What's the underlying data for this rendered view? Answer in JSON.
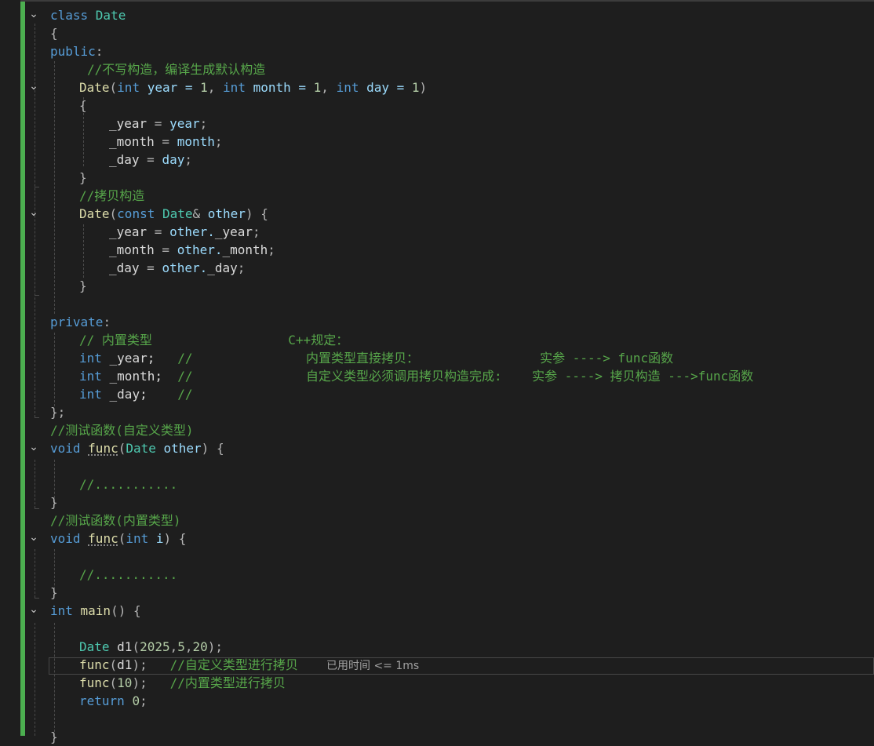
{
  "editor": {
    "lines": [
      {
        "fold": "⌄",
        "tokens": [
          {
            "t": "class ",
            "c": "kw"
          },
          {
            "t": "Date",
            "c": "type"
          }
        ]
      },
      {
        "tokens": [
          {
            "t": "{",
            "c": "punct"
          }
        ]
      },
      {
        "tokens": [
          {
            "t": "public",
            "c": "kw"
          },
          {
            "t": ":",
            "c": "punct"
          }
        ]
      },
      {
        "tokens": [
          {
            "t": "//不写构造，编译生成默认构造",
            "c": "cmt"
          }
        ]
      },
      {
        "fold": "⌄",
        "tokens": [
          {
            "t": "Date",
            "c": "fn"
          },
          {
            "t": "(",
            "c": "punct"
          },
          {
            "t": "int",
            "c": "kw"
          },
          {
            "t": " year = ",
            "c": "param"
          },
          {
            "t": "1",
            "c": "num"
          },
          {
            "t": ", ",
            "c": "punct"
          },
          {
            "t": "int",
            "c": "kw"
          },
          {
            "t": " month = ",
            "c": "param"
          },
          {
            "t": "1",
            "c": "num"
          },
          {
            "t": ", ",
            "c": "punct"
          },
          {
            "t": "int",
            "c": "kw"
          },
          {
            "t": " day = ",
            "c": "param"
          },
          {
            "t": "1",
            "c": "num"
          },
          {
            "t": ")",
            "c": "punct"
          }
        ]
      },
      {
        "tokens": [
          {
            "t": "{",
            "c": "punct"
          }
        ]
      },
      {
        "tokens": [
          {
            "t": "_year",
            "c": "field"
          },
          {
            "t": " = ",
            "c": "punct"
          },
          {
            "t": "year",
            "c": "param"
          },
          {
            "t": ";",
            "c": "punct"
          }
        ]
      },
      {
        "tokens": [
          {
            "t": "_month",
            "c": "field"
          },
          {
            "t": " = ",
            "c": "punct"
          },
          {
            "t": "month",
            "c": "param"
          },
          {
            "t": ";",
            "c": "punct"
          }
        ]
      },
      {
        "tokens": [
          {
            "t": "_day",
            "c": "field"
          },
          {
            "t": " = ",
            "c": "punct"
          },
          {
            "t": "day",
            "c": "param"
          },
          {
            "t": ";",
            "c": "punct"
          }
        ]
      },
      {
        "tokens": [
          {
            "t": "}",
            "c": "punct"
          }
        ]
      },
      {
        "tokens": [
          {
            "t": "//拷贝构造",
            "c": "cmt"
          }
        ]
      },
      {
        "fold": "⌄",
        "tokens": [
          {
            "t": "Date",
            "c": "fn"
          },
          {
            "t": "(",
            "c": "punct"
          },
          {
            "t": "const",
            "c": "kw"
          },
          {
            "t": " ",
            "c": "punct"
          },
          {
            "t": "Date",
            "c": "type"
          },
          {
            "t": "& ",
            "c": "punct"
          },
          {
            "t": "other",
            "c": "param"
          },
          {
            "t": ") {",
            "c": "punct"
          }
        ]
      },
      {
        "tokens": [
          {
            "t": "_year",
            "c": "field"
          },
          {
            "t": " = ",
            "c": "punct"
          },
          {
            "t": "other.",
            "c": "param"
          },
          {
            "t": "_year",
            "c": "field"
          },
          {
            "t": ";",
            "c": "punct"
          }
        ]
      },
      {
        "tokens": [
          {
            "t": "_month",
            "c": "field"
          },
          {
            "t": " = ",
            "c": "punct"
          },
          {
            "t": "other.",
            "c": "param"
          },
          {
            "t": "_month",
            "c": "field"
          },
          {
            "t": ";",
            "c": "punct"
          }
        ]
      },
      {
        "tokens": [
          {
            "t": "_day",
            "c": "field"
          },
          {
            "t": " = ",
            "c": "punct"
          },
          {
            "t": "other.",
            "c": "param"
          },
          {
            "t": "_day",
            "c": "field"
          },
          {
            "t": ";",
            "c": "punct"
          }
        ]
      },
      {
        "tokens": [
          {
            "t": "}",
            "c": "punct"
          }
        ]
      },
      {
        "tokens": []
      },
      {
        "tokens": [
          {
            "t": "private",
            "c": "kw"
          },
          {
            "t": ":",
            "c": "punct"
          }
        ]
      },
      {
        "tokens": [
          {
            "t": "// 内置类型                  C++规定：",
            "c": "cmt"
          }
        ]
      },
      {
        "tokens": [
          {
            "t": "int",
            "c": "kw"
          },
          {
            "t": " _year;   ",
            "c": "field"
          },
          {
            "t": "//               内置类型直接拷贝：                实参 ----> func函数",
            "c": "cmt"
          }
        ]
      },
      {
        "tokens": [
          {
            "t": "int",
            "c": "kw"
          },
          {
            "t": " _month;  ",
            "c": "field"
          },
          {
            "t": "//               自定义类型必须调用拷贝构造完成:    实参 ----> 拷贝构造 --->func函数",
            "c": "cmt"
          }
        ]
      },
      {
        "tokens": [
          {
            "t": "int",
            "c": "kw"
          },
          {
            "t": " _day;    ",
            "c": "field"
          },
          {
            "t": "//",
            "c": "cmt"
          }
        ]
      },
      {
        "tokens": [
          {
            "t": "};",
            "c": "punct"
          }
        ]
      },
      {
        "tokens": [
          {
            "t": "//测试函数(自定义类型)",
            "c": "cmt"
          }
        ]
      },
      {
        "fold": "⌄",
        "tokens": [
          {
            "t": "void ",
            "c": "kw"
          },
          {
            "t": "func",
            "c": "fn",
            "squiggle": true
          },
          {
            "t": "(",
            "c": "punct"
          },
          {
            "t": "Date",
            "c": "type"
          },
          {
            "t": " other",
            "c": "param"
          },
          {
            "t": ") {",
            "c": "punct"
          }
        ]
      },
      {
        "tokens": []
      },
      {
        "tokens": [
          {
            "t": "//...........",
            "c": "cmt"
          }
        ]
      },
      {
        "tokens": [
          {
            "t": "}",
            "c": "punct"
          }
        ]
      },
      {
        "tokens": [
          {
            "t": "//测试函数(内置类型)",
            "c": "cmt"
          }
        ]
      },
      {
        "fold": "⌄",
        "tokens": [
          {
            "t": "void ",
            "c": "kw"
          },
          {
            "t": "func",
            "c": "fn",
            "squiggle": true
          },
          {
            "t": "(",
            "c": "punct"
          },
          {
            "t": "int",
            "c": "kw"
          },
          {
            "t": " i",
            "c": "param"
          },
          {
            "t": ") {",
            "c": "punct"
          }
        ]
      },
      {
        "tokens": []
      },
      {
        "tokens": [
          {
            "t": "//...........",
            "c": "cmt"
          }
        ]
      },
      {
        "tokens": [
          {
            "t": "}",
            "c": "punct"
          }
        ]
      },
      {
        "fold": "⌄",
        "tokens": [
          {
            "t": "int ",
            "c": "kw"
          },
          {
            "t": "main",
            "c": "fn"
          },
          {
            "t": "() {",
            "c": "punct"
          }
        ]
      },
      {
        "tokens": []
      },
      {
        "tokens": [
          {
            "t": "Date",
            "c": "type"
          },
          {
            "t": " d1",
            "c": "field"
          },
          {
            "t": "(",
            "c": "punct"
          },
          {
            "t": "2025",
            "c": "num"
          },
          {
            "t": ",",
            "c": "punct"
          },
          {
            "t": "5",
            "c": "num"
          },
          {
            "t": ",",
            "c": "punct"
          },
          {
            "t": "20",
            "c": "num"
          },
          {
            "t": ");",
            "c": "punct"
          }
        ]
      },
      {
        "tokens": [
          {
            "t": "func",
            "c": "fn"
          },
          {
            "t": "(",
            "c": "punct"
          },
          {
            "t": "d1",
            "c": "field"
          },
          {
            "t": ");   ",
            "c": "punct"
          },
          {
            "t": "//自定义类型进行拷贝",
            "c": "cmt"
          }
        ]
      },
      {
        "tokens": [
          {
            "t": "func",
            "c": "fn"
          },
          {
            "t": "(",
            "c": "punct"
          },
          {
            "t": "10",
            "c": "num"
          },
          {
            "t": ");   ",
            "c": "punct"
          },
          {
            "t": "//内置类型进行拷贝",
            "c": "cmt"
          }
        ]
      },
      {
        "tokens": [
          {
            "t": "return ",
            "c": "kw"
          },
          {
            "t": "0",
            "c": "num"
          },
          {
            "t": ";",
            "c": "punct"
          }
        ]
      },
      {
        "tokens": []
      },
      {
        "tokens": [
          {
            "t": "}",
            "c": "punct"
          }
        ]
      }
    ],
    "perf_tip": "已用时间 <= 1ms"
  }
}
